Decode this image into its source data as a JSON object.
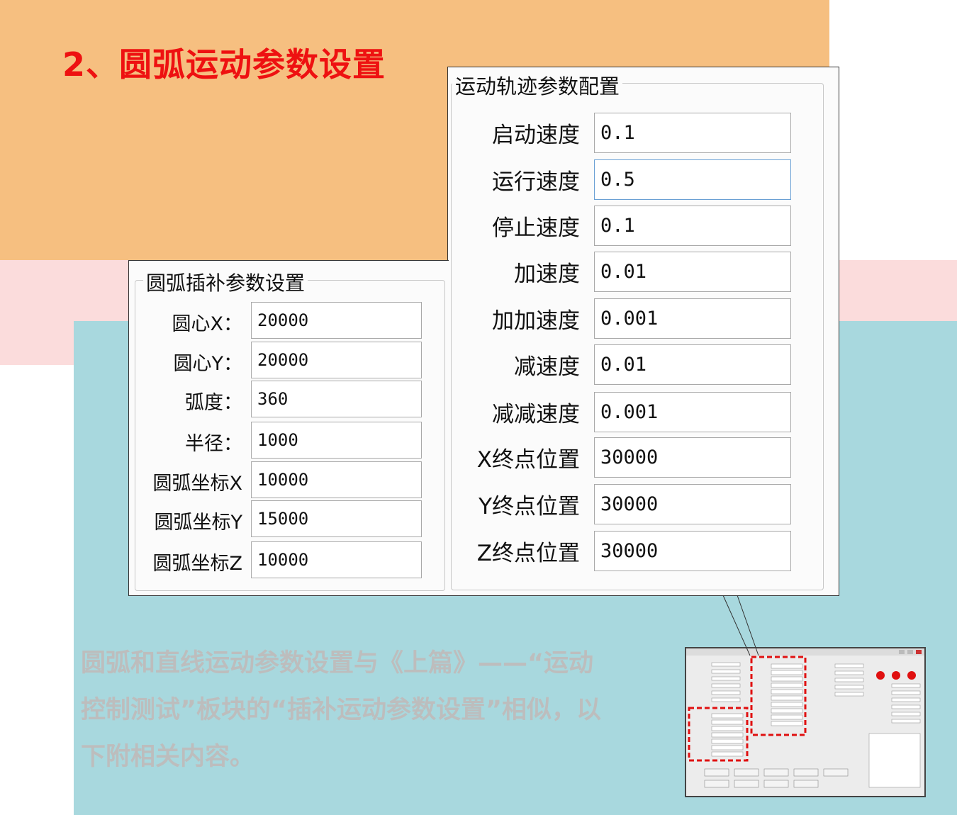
{
  "heading": "2、圆弧运动参数设置",
  "motion_panel": {
    "title": "运动轨迹参数配置",
    "fields": [
      {
        "label": "启动速度",
        "value": "0.1"
      },
      {
        "label": "运行速度",
        "value": "0.5"
      },
      {
        "label": "停止速度",
        "value": "0.1"
      },
      {
        "label": "加速度",
        "value": "0.01"
      },
      {
        "label": "加加速度",
        "value": "0.001"
      },
      {
        "label": "减速度",
        "value": "0.01"
      },
      {
        "label": "减减速度",
        "value": "0.001"
      },
      {
        "label": "X终点位置",
        "value": "30000"
      },
      {
        "label": "Y终点位置",
        "value": "30000"
      },
      {
        "label": "Z终点位置",
        "value": "30000"
      }
    ]
  },
  "arc_panel": {
    "title": "圆弧插补参数设置",
    "fields": [
      {
        "label": "圆心X：",
        "value": "20000"
      },
      {
        "label": "圆心Y：",
        "value": "20000"
      },
      {
        "label": "弧度：",
        "value": "360"
      },
      {
        "label": "半径：",
        "value": "1000"
      },
      {
        "label": "圆弧坐标X",
        "value": "10000"
      },
      {
        "label": "圆弧坐标Y",
        "value": "15000"
      },
      {
        "label": "圆弧坐标Z",
        "value": "10000"
      }
    ]
  },
  "description": "圆弧和直线运动参数设置与《上篇》——“运动控制测试”板块的“插补运动参数设置”相似，以下附相关内容。",
  "colors": {
    "heading": "#ee1111",
    "orange_bg": "#f6bf80",
    "pink_bg": "#fbdcdc",
    "teal_bg": "#a8d8de",
    "highlight": "#e01010",
    "indicator": "#e01010"
  }
}
